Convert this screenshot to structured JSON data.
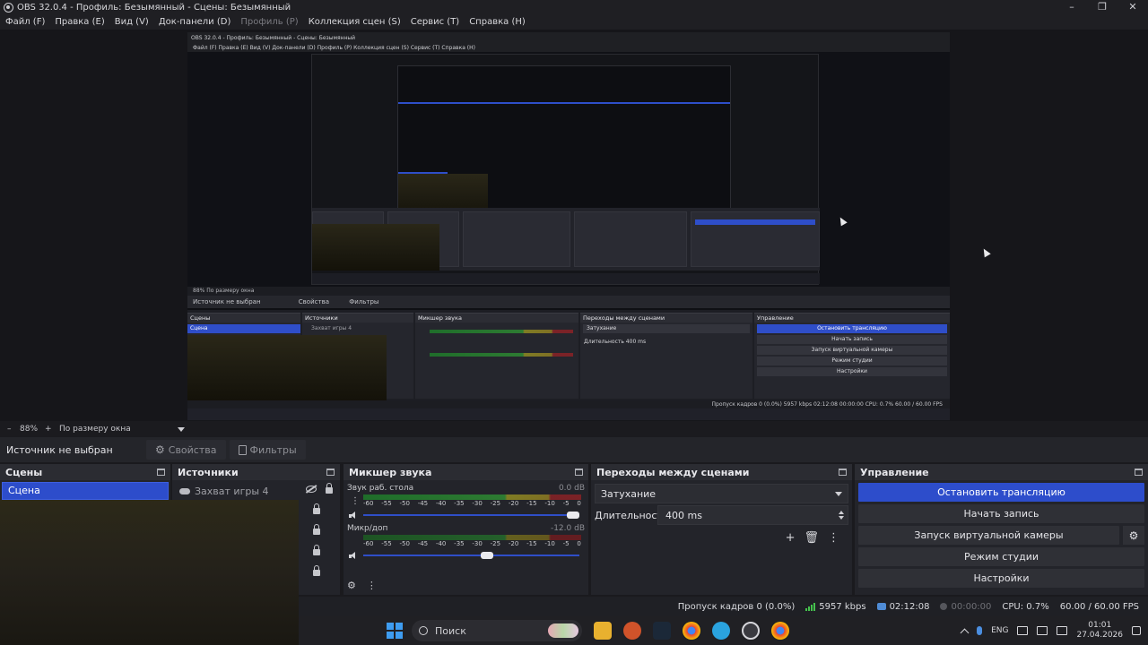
{
  "window": {
    "title": "OBS 32.0.4 - Профиль: Безымянный - Сцены: Безымянный",
    "minimize": "–",
    "maximize": "❐",
    "close": "✕"
  },
  "menu": {
    "items": [
      {
        "label": "Файл (F)",
        "enabled": true
      },
      {
        "label": "Правка (E)",
        "enabled": true
      },
      {
        "label": "Вид (V)",
        "enabled": true
      },
      {
        "label": "Док-панели (D)",
        "enabled": true
      },
      {
        "label": "Профиль (P)",
        "enabled": false
      },
      {
        "label": "Коллекция сцен (S)",
        "enabled": true
      },
      {
        "label": "Сервис (T)",
        "enabled": true
      },
      {
        "label": "Справка (H)",
        "enabled": true
      }
    ]
  },
  "nested": {
    "title": "OBS 32.0.4 - Профиль: Безымянный - Сцены: Безымянный",
    "menu": "Файл (F)   Правка (E)   Вид (V)   Док-панели (D)   Профиль (P)   Коллекция сцен (S)   Сервис (T)   Справка (H)",
    "zoom": "88%   По размеру окна",
    "no_source": "Источник не выбран",
    "props": "Свойства",
    "filters": "Фильтры",
    "scenes_title": "Сцены",
    "scene_item": "Сцена",
    "sources_title": "Источники",
    "source_item": "Захват игры 4",
    "mixer_title": "Микшер звука",
    "trans_title": "Переходы между сценами",
    "trans_value": "Затухание",
    "duration": "Длительность   400 ms",
    "controls_title": "Управление",
    "btn_stop": "Остановить трансляцию",
    "btn_rec": "Начать запись",
    "btn_vcam": "Запуск виртуальной камеры",
    "btn_studio": "Режим студии",
    "btn_settings": "Настройки",
    "status": "Пропуск кадров 0 (0.0%)   5957 kbps   02:12:08   00:00:00   CPU: 0.7%   60.00 / 60.00 FPS"
  },
  "preview_toolbar": {
    "zoom_minus": "–",
    "zoom": "88%",
    "zoom_plus": "+",
    "fit": "По размеру окна"
  },
  "source_bar": {
    "no_source": "Источник не выбран",
    "properties": "Свойства",
    "filters": "Фильтры"
  },
  "scenes": {
    "title": "Сцены",
    "items": [
      "Сцена"
    ]
  },
  "sources": {
    "title": "Источники",
    "items": [
      {
        "label": "Захват игры 4",
        "icon": "gamepad-icon"
      }
    ]
  },
  "mixer": {
    "title": "Микшер звука",
    "scale": [
      "-60",
      "-55",
      "-50",
      "-45",
      "-40",
      "-35",
      "-30",
      "-25",
      "-20",
      "-15",
      "-10",
      "-5",
      "0"
    ],
    "channels": [
      {
        "name": "Звук раб. стола",
        "db": "0.0 dB",
        "volume_fraction": 1.0
      },
      {
        "name": "Микр/доп",
        "db": "-12.0 dB",
        "volume_fraction": 0.6
      }
    ]
  },
  "transitions": {
    "title": "Переходы между сценами",
    "selected": "Затухание",
    "duration_label": "Длительность",
    "duration_value": "400 ms",
    "add": "+",
    "delete": "🗑",
    "more": "⋮"
  },
  "controls": {
    "title": "Управление",
    "stop_stream": "Остановить трансляцию",
    "start_record": "Начать запись",
    "virtual_cam": "Запуск виртуальной камеры",
    "studio_mode": "Режим студии",
    "settings": "Настройки"
  },
  "status": {
    "dropped": "Пропуск кадров 0 (0.0%)",
    "bitrate": "5957 kbps",
    "stream_time": "02:12:08",
    "rec_time": "00:00:00",
    "cpu": "CPU: 0.7%",
    "fps": "60.00 / 60.00 FPS"
  },
  "taskbar": {
    "search": "Поиск",
    "lang": "ENG",
    "time": "01:01",
    "date": "27.04.2026"
  },
  "colors": {
    "accent": "#2d4dcb",
    "meter_green": "#2f8a33",
    "meter_yellow": "#8f8b22",
    "meter_red": "#8a2226"
  }
}
